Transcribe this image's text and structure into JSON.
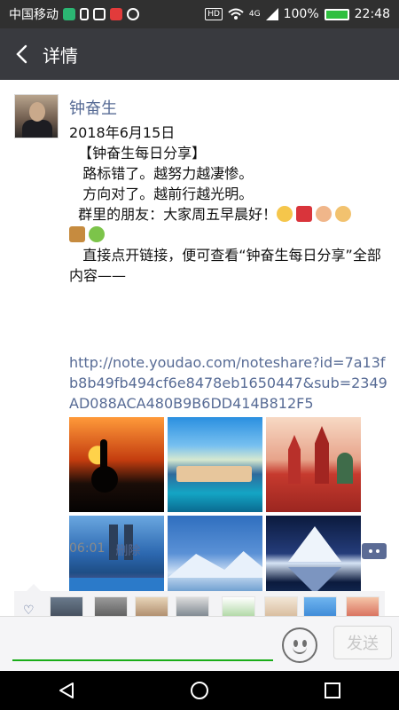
{
  "status_bar": {
    "carrier": "中国移动",
    "hd_label": "HD",
    "signal_label": "4G",
    "battery_percent": "100%",
    "time": "22:48"
  },
  "nav": {
    "title": "详情"
  },
  "post": {
    "author": "钟奋生",
    "lines": [
      "2018年6月15日",
      "  【钟奋生每日分享】",
      "   路标错了。越努力越凄惨。",
      "   方向对了。越前行越光明。",
      "  群里的朋友：大家周五早晨好！",
      "",
      "   直接点开链接，便可查看“钟奋生每日分享”全部内容——"
    ],
    "link": "http://note.youdao.com/noteshare?id=7a13fb8b49fb494cf6e8478eb1650447&sub=2349AD088ACA480B9B6DD414B812F5",
    "time": "06:01",
    "delete_label": "删除"
  },
  "input": {
    "send_label": "发送"
  },
  "colors": {
    "nav_bg": "#393a3f",
    "link": "#576b95",
    "accent_green": "#1aad19"
  },
  "icons": {
    "back": "back-arrow-icon",
    "heart": "heart-icon",
    "comment": "comment-icon",
    "emoji": "emoji-icon",
    "sys_back": "triangle-back-icon",
    "sys_home": "circle-home-icon",
    "sys_recent": "square-recent-icon"
  }
}
